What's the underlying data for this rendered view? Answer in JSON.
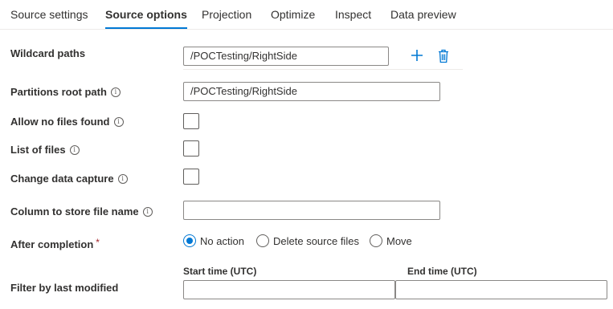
{
  "tabs": [
    {
      "label": "Source settings",
      "active": false
    },
    {
      "label": "Source options",
      "active": true
    },
    {
      "label": "Projection",
      "active": false
    },
    {
      "label": "Optimize",
      "active": false
    },
    {
      "label": "Inspect",
      "active": false
    },
    {
      "label": "Data preview",
      "active": false
    }
  ],
  "wildcard": {
    "label": "Wildcard paths",
    "value": "/POCTesting/RightSide"
  },
  "partitions_root": {
    "label": "Partitions root path",
    "value": "/POCTesting/RightSide"
  },
  "allow_no_files": {
    "label": "Allow no files found",
    "checked": false
  },
  "list_of_files": {
    "label": "List of files",
    "checked": false
  },
  "change_data_capture": {
    "label": "Change data capture",
    "checked": false
  },
  "column_file_name": {
    "label": "Column to store file name",
    "value": ""
  },
  "after_completion": {
    "label": "After completion",
    "required_mark": "*",
    "options": [
      {
        "label": "No action",
        "selected": true
      },
      {
        "label": "Delete source files",
        "selected": false
      },
      {
        "label": "Move",
        "selected": false
      }
    ]
  },
  "filter_last_modified": {
    "label": "Filter by last modified",
    "start_label": "Start time (UTC)",
    "end_label": "End time (UTC)",
    "start_value": "",
    "end_value": ""
  },
  "icons": {
    "info": "info-icon",
    "add": "plus-icon",
    "delete": "trash-icon"
  },
  "colors": {
    "accent": "#0078d4",
    "required": "#a4262c",
    "border": "#8a8886"
  }
}
